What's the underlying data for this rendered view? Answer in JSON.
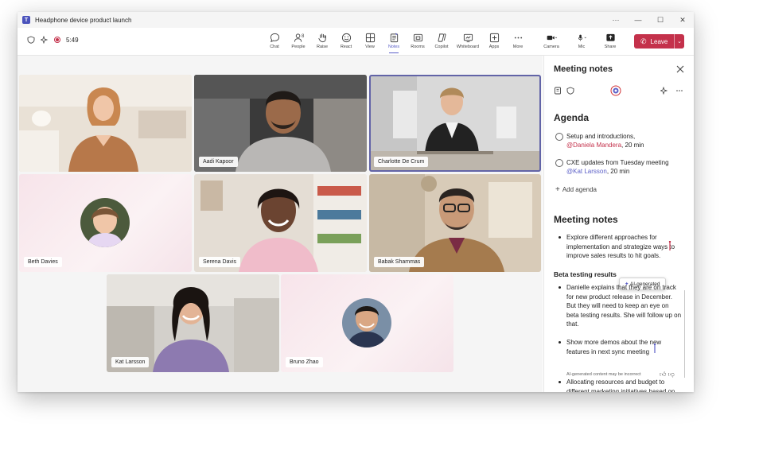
{
  "window": {
    "title": "Headphone device product launch",
    "controls": [
      "···",
      "—",
      "☐",
      "✕"
    ]
  },
  "toolbar": {
    "timer": "5:49",
    "tools": [
      {
        "name": "chat-tool",
        "label": "Chat",
        "icon": "chat-icon"
      },
      {
        "name": "people-tool",
        "label": "People",
        "icon": "people-icon",
        "badge": "8"
      },
      {
        "name": "raise-tool",
        "label": "Raise",
        "icon": "hand-icon"
      },
      {
        "name": "react-tool",
        "label": "React",
        "icon": "smile-icon"
      },
      {
        "name": "view-tool",
        "label": "View",
        "icon": "grid-icon"
      },
      {
        "name": "notes-tool",
        "label": "Notes",
        "icon": "notes-icon",
        "active": true
      },
      {
        "name": "rooms-tool",
        "label": "Rooms",
        "icon": "rooms-icon"
      },
      {
        "name": "copilot-tool",
        "label": "Copilot",
        "icon": "copilot-icon"
      },
      {
        "name": "whiteboard-tool",
        "label": "Whiteboard",
        "icon": "whiteboard-icon"
      },
      {
        "name": "apps-tool",
        "label": "Apps",
        "icon": "plus-icon"
      },
      {
        "name": "more-tool",
        "label": "More",
        "icon": "more-icon"
      }
    ],
    "camera_label": "Camera",
    "mic_label": "Mic",
    "share_label": "Share",
    "leave_label": "Leave"
  },
  "participants": [
    {
      "name": "",
      "bg": "#d9cfc4"
    },
    {
      "name": "Aadi Kapoor",
      "bg": "#b8b0a7"
    },
    {
      "name": "Charlotte De Crum",
      "bg": "#cfcfcf"
    },
    {
      "name": "Beth Davies",
      "bg": "#f6e6ec"
    },
    {
      "name": "Serena Davis",
      "bg": "#d8d3cc"
    },
    {
      "name": "Babak Shammas",
      "bg": "#cbbca9"
    },
    {
      "name": "Kat Larsson",
      "bg": "#c9c6c2"
    },
    {
      "name": "Bruno Zhao",
      "bg": "#f6e6ec"
    }
  ],
  "notes_panel": {
    "title": "Meeting notes",
    "agenda_heading": "Agenda",
    "agenda": [
      {
        "text": "Setup and introductions,",
        "mention": "@Daniela Mandera",
        "duration": ", 20 min"
      },
      {
        "text": "CXE updates from Tuesday meeting",
        "mention": "@Kat Larsson",
        "duration": ", 20 min"
      }
    ],
    "add_agenda": "Add agenda",
    "notes_heading": "Meeting notes",
    "bullet1": "Explore different approaches for implementation and strategize ways to improve sales results to hit goals.",
    "subheading": "Beta testing results",
    "bullet2": "Danielle explains that they are on track for new product release in December. But they will need to keep an eye on beta testing results. She will follow up on that.",
    "bullet3": "Show more demos about the new features in next sync meeting",
    "ai_label": "AI-generated",
    "ai_disclaimer": "AI-generated content may be incorrect",
    "bullet4": "Allocating resources and budget to different marketing initiatives based on"
  }
}
